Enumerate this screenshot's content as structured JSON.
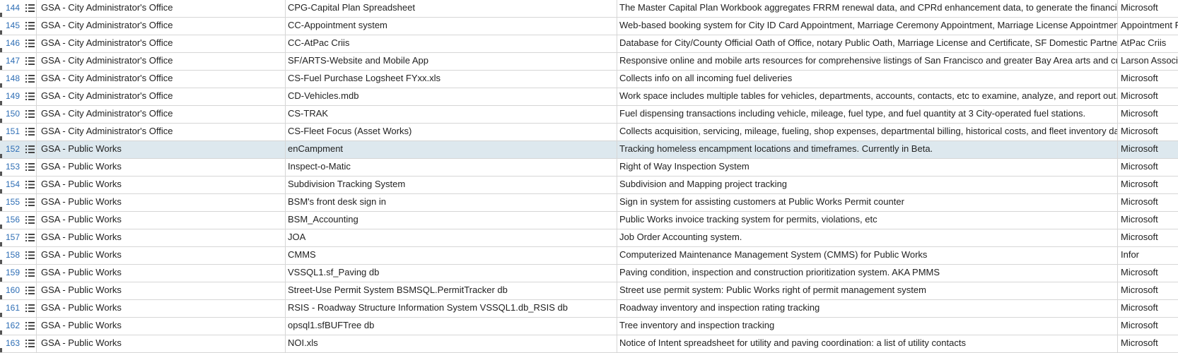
{
  "table": {
    "rows": [
      {
        "num": "144",
        "dept": "GSA - City Administrator's Office",
        "system": "CPG-Capital Plan Spreadsheet",
        "desc": "The Master Capital Plan Workbook aggregates FRRM renewal data, and CPRd enhancement data, to generate the financial tables and",
        "vendor": "Microsoft",
        "selected": false
      },
      {
        "num": "145",
        "dept": "GSA - City Administrator's Office",
        "system": "CC-Appointment system",
        "desc": "Web-based booking system for City ID Card Appointment, Marriage Ceremony Appointment, Marriage License Appointment, Military F",
        "vendor": "Appointment Pr",
        "selected": false
      },
      {
        "num": "146",
        "dept": "GSA - City Administrator's Office",
        "system": "CC-AtPac Criis",
        "desc": "Database for City/County Official Oath of Office, notary Public Oath, Marriage License and Certificate, SF Domestic Partnership Regis",
        "vendor": "AtPac Criis",
        "selected": false
      },
      {
        "num": "147",
        "dept": "GSA - City Administrator's Office",
        "system": "SF/ARTS-Website and Mobile App",
        "desc": "Responsive online and mobile arts resources for comprehensive listings of San Francisco and greater Bay Area arts and cultural even",
        "vendor": "Larson Associa",
        "selected": false
      },
      {
        "num": "148",
        "dept": "GSA - City Administrator's Office",
        "system": "CS-Fuel Purchase Logsheet FYxx.xls",
        "desc": "Collects info on all incoming fuel deliveries",
        "vendor": "Microsoft",
        "selected": false
      },
      {
        "num": "149",
        "dept": "GSA - City Administrator's Office",
        "system": "CD-Vehicles.mdb",
        "desc": "Work space includes multiple tables for vehicles, departments, accounts, contacts, etc to examine, analyze, and report out.",
        "vendor": "Microsoft",
        "selected": false
      },
      {
        "num": "150",
        "dept": "GSA - City Administrator's Office",
        "system": "CS-TRAK",
        "desc": "Fuel dispensing transactions including vehicle, mileage, fuel type, and fuel quantity at 3 City-operated fuel stations.",
        "vendor": "Microsoft",
        "selected": false
      },
      {
        "num": "151",
        "dept": "GSA - City Administrator's Office",
        "system": "CS-Fleet Focus (Asset Works)",
        "desc": "Collects acquisition, servicing, mileage, fueling, shop expenses, departmental billing, historical costs, and fleet inventory data.",
        "vendor": "Microsoft",
        "selected": false
      },
      {
        "num": "152",
        "dept": "GSA - Public Works",
        "system": "enCampment",
        "desc": "Tracking homeless encampment locations and timeframes. Currently in Beta.",
        "vendor": "Microsoft",
        "selected": true
      },
      {
        "num": "153",
        "dept": "GSA - Public Works",
        "system": "Inspect-o-Matic",
        "desc": "Right of Way Inspection System",
        "vendor": "Microsoft",
        "selected": false
      },
      {
        "num": "154",
        "dept": "GSA - Public Works",
        "system": "Subdivision Tracking System",
        "desc": "Subdivision and Mapping project tracking",
        "vendor": "Microsoft",
        "selected": false
      },
      {
        "num": "155",
        "dept": "GSA - Public Works",
        "system": "BSM's front desk sign in",
        "desc": "Sign in system for assisting customers at Public Works Permit counter",
        "vendor": "Microsoft",
        "selected": false
      },
      {
        "num": "156",
        "dept": "GSA - Public Works",
        "system": "BSM_Accounting",
        "desc": "Public Works invoice tracking system for permits, violations, etc",
        "vendor": "Microsoft",
        "selected": false
      },
      {
        "num": "157",
        "dept": "GSA - Public Works",
        "system": "JOA",
        "desc": "Job Order Accounting system.",
        "vendor": "Microsoft",
        "selected": false
      },
      {
        "num": "158",
        "dept": "GSA - Public Works",
        "system": "CMMS",
        "desc": "Computerized Maintenance Management System (CMMS) for Public Works",
        "vendor": "Infor",
        "selected": false
      },
      {
        "num": "159",
        "dept": "GSA - Public Works",
        "system": "VSSQL1.sf_Paving db",
        "desc": "Paving condition, inspection and construction prioritization system. AKA PMMS",
        "vendor": "Microsoft",
        "selected": false
      },
      {
        "num": "160",
        "dept": "GSA - Public Works",
        "system": "Street-Use Permit System BSMSQL.PermitTracker db",
        "desc": "Street use permit system: Public Works right of permit management system",
        "vendor": "Microsoft",
        "selected": false
      },
      {
        "num": "161",
        "dept": "GSA - Public Works",
        "system": "RSIS - Roadway Structure Information System VSSQL1.db_RSIS db",
        "desc": "Roadway inventory and inspection rating tracking",
        "vendor": "Microsoft",
        "selected": false
      },
      {
        "num": "162",
        "dept": "GSA - Public Works",
        "system": "opsql1.sfBUFTree db",
        "desc": "Tree inventory and inspection tracking",
        "vendor": "Microsoft",
        "selected": false
      },
      {
        "num": "163",
        "dept": "GSA - Public Works",
        "system": "NOI.xls",
        "desc": "Notice of Intent spreadsheet for utility and paving coordination: a list of utility contacts",
        "vendor": "Microsoft",
        "selected": false
      }
    ]
  },
  "icons": {
    "row_menu": "row-menu-icon"
  },
  "colors": {
    "row_number": "#2e6eb5",
    "selected_row": "#dde8ee",
    "grid_line": "#d6d6d6"
  }
}
